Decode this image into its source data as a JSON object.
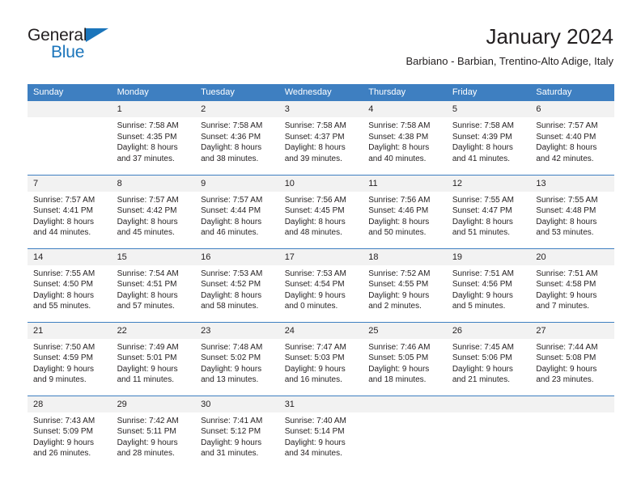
{
  "brand": {
    "name_top": "General",
    "name_bottom": "Blue",
    "accent_color": "#1b75bb",
    "triangle_icon": "triangle-logo-icon"
  },
  "header": {
    "title": "January 2024",
    "subtitle": "Barbiano - Barbian, Trentino-Alto Adige, Italy"
  },
  "calendar": {
    "header_bg": "#3e7fc1",
    "daynum_bg": "#f2f2f2",
    "weekday_headers": [
      "Sunday",
      "Monday",
      "Tuesday",
      "Wednesday",
      "Thursday",
      "Friday",
      "Saturday"
    ],
    "weeks": [
      [
        {
          "day": "",
          "blank": true,
          "lines": []
        },
        {
          "day": "1",
          "lines": [
            "Sunrise: 7:58 AM",
            "Sunset: 4:35 PM",
            "Daylight: 8 hours",
            "and 37 minutes."
          ]
        },
        {
          "day": "2",
          "lines": [
            "Sunrise: 7:58 AM",
            "Sunset: 4:36 PM",
            "Daylight: 8 hours",
            "and 38 minutes."
          ]
        },
        {
          "day": "3",
          "lines": [
            "Sunrise: 7:58 AM",
            "Sunset: 4:37 PM",
            "Daylight: 8 hours",
            "and 39 minutes."
          ]
        },
        {
          "day": "4",
          "lines": [
            "Sunrise: 7:58 AM",
            "Sunset: 4:38 PM",
            "Daylight: 8 hours",
            "and 40 minutes."
          ]
        },
        {
          "day": "5",
          "lines": [
            "Sunrise: 7:58 AM",
            "Sunset: 4:39 PM",
            "Daylight: 8 hours",
            "and 41 minutes."
          ]
        },
        {
          "day": "6",
          "lines": [
            "Sunrise: 7:57 AM",
            "Sunset: 4:40 PM",
            "Daylight: 8 hours",
            "and 42 minutes."
          ]
        }
      ],
      [
        {
          "day": "7",
          "lines": [
            "Sunrise: 7:57 AM",
            "Sunset: 4:41 PM",
            "Daylight: 8 hours",
            "and 44 minutes."
          ]
        },
        {
          "day": "8",
          "lines": [
            "Sunrise: 7:57 AM",
            "Sunset: 4:42 PM",
            "Daylight: 8 hours",
            "and 45 minutes."
          ]
        },
        {
          "day": "9",
          "lines": [
            "Sunrise: 7:57 AM",
            "Sunset: 4:44 PM",
            "Daylight: 8 hours",
            "and 46 minutes."
          ]
        },
        {
          "day": "10",
          "lines": [
            "Sunrise: 7:56 AM",
            "Sunset: 4:45 PM",
            "Daylight: 8 hours",
            "and 48 minutes."
          ]
        },
        {
          "day": "11",
          "lines": [
            "Sunrise: 7:56 AM",
            "Sunset: 4:46 PM",
            "Daylight: 8 hours",
            "and 50 minutes."
          ]
        },
        {
          "day": "12",
          "lines": [
            "Sunrise: 7:55 AM",
            "Sunset: 4:47 PM",
            "Daylight: 8 hours",
            "and 51 minutes."
          ]
        },
        {
          "day": "13",
          "lines": [
            "Sunrise: 7:55 AM",
            "Sunset: 4:48 PM",
            "Daylight: 8 hours",
            "and 53 minutes."
          ]
        }
      ],
      [
        {
          "day": "14",
          "lines": [
            "Sunrise: 7:55 AM",
            "Sunset: 4:50 PM",
            "Daylight: 8 hours",
            "and 55 minutes."
          ]
        },
        {
          "day": "15",
          "lines": [
            "Sunrise: 7:54 AM",
            "Sunset: 4:51 PM",
            "Daylight: 8 hours",
            "and 57 minutes."
          ]
        },
        {
          "day": "16",
          "lines": [
            "Sunrise: 7:53 AM",
            "Sunset: 4:52 PM",
            "Daylight: 8 hours",
            "and 58 minutes."
          ]
        },
        {
          "day": "17",
          "lines": [
            "Sunrise: 7:53 AM",
            "Sunset: 4:54 PM",
            "Daylight: 9 hours",
            "and 0 minutes."
          ]
        },
        {
          "day": "18",
          "lines": [
            "Sunrise: 7:52 AM",
            "Sunset: 4:55 PM",
            "Daylight: 9 hours",
            "and 2 minutes."
          ]
        },
        {
          "day": "19",
          "lines": [
            "Sunrise: 7:51 AM",
            "Sunset: 4:56 PM",
            "Daylight: 9 hours",
            "and 5 minutes."
          ]
        },
        {
          "day": "20",
          "lines": [
            "Sunrise: 7:51 AM",
            "Sunset: 4:58 PM",
            "Daylight: 9 hours",
            "and 7 minutes."
          ]
        }
      ],
      [
        {
          "day": "21",
          "lines": [
            "Sunrise: 7:50 AM",
            "Sunset: 4:59 PM",
            "Daylight: 9 hours",
            "and 9 minutes."
          ]
        },
        {
          "day": "22",
          "lines": [
            "Sunrise: 7:49 AM",
            "Sunset: 5:01 PM",
            "Daylight: 9 hours",
            "and 11 minutes."
          ]
        },
        {
          "day": "23",
          "lines": [
            "Sunrise: 7:48 AM",
            "Sunset: 5:02 PM",
            "Daylight: 9 hours",
            "and 13 minutes."
          ]
        },
        {
          "day": "24",
          "lines": [
            "Sunrise: 7:47 AM",
            "Sunset: 5:03 PM",
            "Daylight: 9 hours",
            "and 16 minutes."
          ]
        },
        {
          "day": "25",
          "lines": [
            "Sunrise: 7:46 AM",
            "Sunset: 5:05 PM",
            "Daylight: 9 hours",
            "and 18 minutes."
          ]
        },
        {
          "day": "26",
          "lines": [
            "Sunrise: 7:45 AM",
            "Sunset: 5:06 PM",
            "Daylight: 9 hours",
            "and 21 minutes."
          ]
        },
        {
          "day": "27",
          "lines": [
            "Sunrise: 7:44 AM",
            "Sunset: 5:08 PM",
            "Daylight: 9 hours",
            "and 23 minutes."
          ]
        }
      ],
      [
        {
          "day": "28",
          "lines": [
            "Sunrise: 7:43 AM",
            "Sunset: 5:09 PM",
            "Daylight: 9 hours",
            "and 26 minutes."
          ]
        },
        {
          "day": "29",
          "lines": [
            "Sunrise: 7:42 AM",
            "Sunset: 5:11 PM",
            "Daylight: 9 hours",
            "and 28 minutes."
          ]
        },
        {
          "day": "30",
          "lines": [
            "Sunrise: 7:41 AM",
            "Sunset: 5:12 PM",
            "Daylight: 9 hours",
            "and 31 minutes."
          ]
        },
        {
          "day": "31",
          "lines": [
            "Sunrise: 7:40 AM",
            "Sunset: 5:14 PM",
            "Daylight: 9 hours",
            "and 34 minutes."
          ]
        },
        {
          "day": "",
          "blank": true,
          "lines": []
        },
        {
          "day": "",
          "blank": true,
          "lines": []
        },
        {
          "day": "",
          "blank": true,
          "lines": []
        }
      ]
    ]
  }
}
